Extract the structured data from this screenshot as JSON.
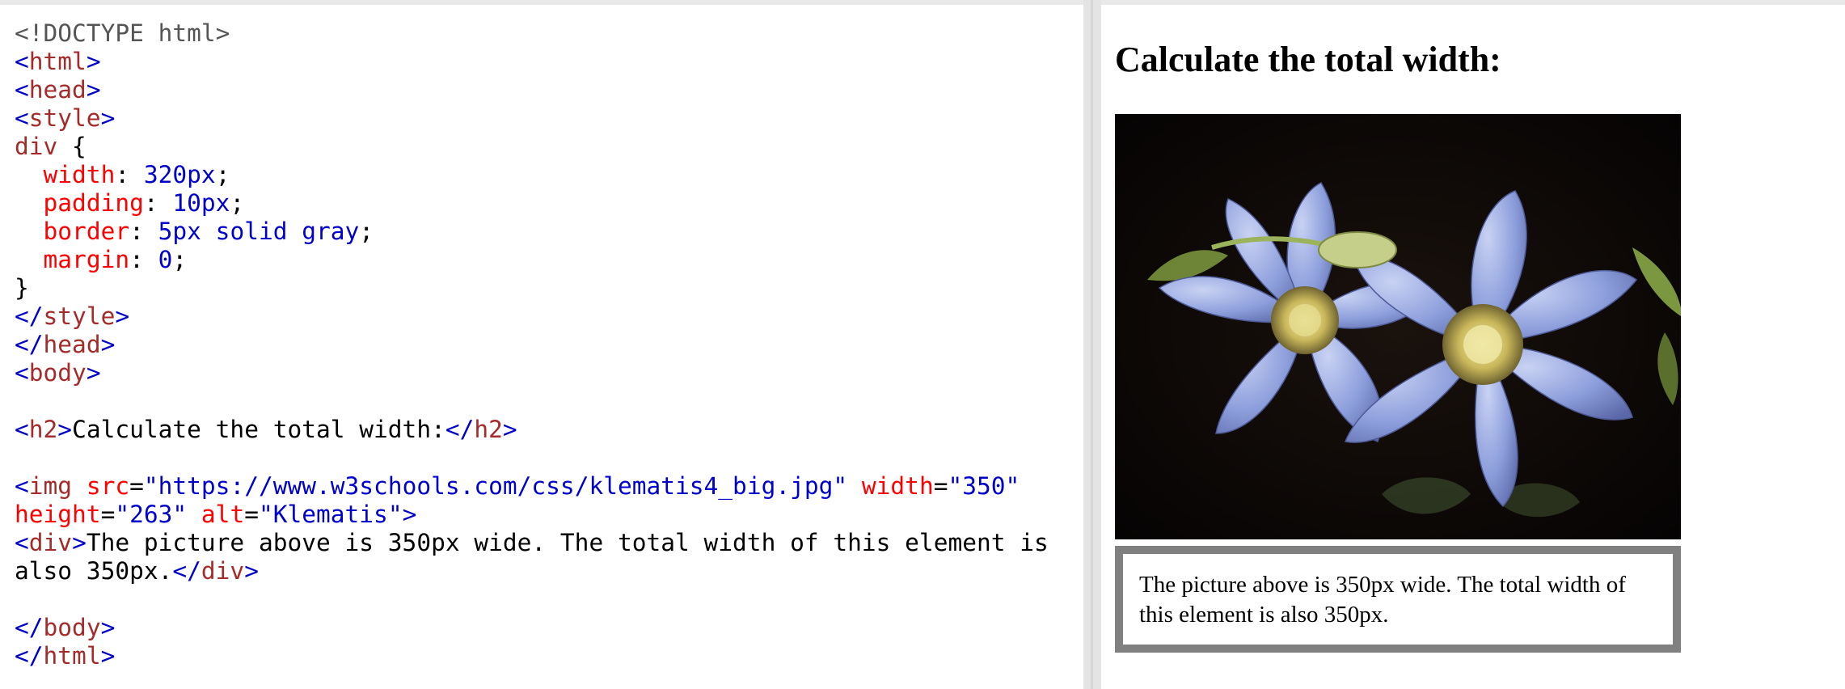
{
  "editor": {
    "lines": [
      [
        {
          "t": "<!DOCTYPE html>",
          "c": "t-doctype"
        }
      ],
      [
        {
          "t": "<",
          "c": "t-bracket"
        },
        {
          "t": "html",
          "c": "t-tag"
        },
        {
          "t": ">",
          "c": "t-bracket"
        }
      ],
      [
        {
          "t": "<",
          "c": "t-bracket"
        },
        {
          "t": "head",
          "c": "t-tag"
        },
        {
          "t": ">",
          "c": "t-bracket"
        }
      ],
      [
        {
          "t": "<",
          "c": "t-bracket"
        },
        {
          "t": "style",
          "c": "t-tag"
        },
        {
          "t": ">",
          "c": "t-bracket"
        }
      ],
      [
        {
          "t": "div",
          "c": "t-sel"
        },
        {
          "t": " {",
          "c": "t-punc"
        }
      ],
      [
        {
          "t": "  ",
          "c": "t-punc"
        },
        {
          "t": "width",
          "c": "t-prop"
        },
        {
          "t": ": ",
          "c": "t-punc"
        },
        {
          "t": "320px",
          "c": "t-pval"
        },
        {
          "t": ";",
          "c": "t-punc"
        }
      ],
      [
        {
          "t": "  ",
          "c": "t-punc"
        },
        {
          "t": "padding",
          "c": "t-prop"
        },
        {
          "t": ": ",
          "c": "t-punc"
        },
        {
          "t": "10px",
          "c": "t-pval"
        },
        {
          "t": ";",
          "c": "t-punc"
        }
      ],
      [
        {
          "t": "  ",
          "c": "t-punc"
        },
        {
          "t": "border",
          "c": "t-prop"
        },
        {
          "t": ": ",
          "c": "t-punc"
        },
        {
          "t": "5px solid gray",
          "c": "t-pval"
        },
        {
          "t": ";",
          "c": "t-punc"
        }
      ],
      [
        {
          "t": "  ",
          "c": "t-punc"
        },
        {
          "t": "margin",
          "c": "t-prop"
        },
        {
          "t": ": ",
          "c": "t-punc"
        },
        {
          "t": "0",
          "c": "t-pval"
        },
        {
          "t": ";",
          "c": "t-punc"
        }
      ],
      [
        {
          "t": "}",
          "c": "t-punc"
        }
      ],
      [
        {
          "t": "</",
          "c": "t-bracket"
        },
        {
          "t": "style",
          "c": "t-tag"
        },
        {
          "t": ">",
          "c": "t-bracket"
        }
      ],
      [
        {
          "t": "</",
          "c": "t-bracket"
        },
        {
          "t": "head",
          "c": "t-tag"
        },
        {
          "t": ">",
          "c": "t-bracket"
        }
      ],
      [
        {
          "t": "<",
          "c": "t-bracket"
        },
        {
          "t": "body",
          "c": "t-tag"
        },
        {
          "t": ">",
          "c": "t-bracket"
        }
      ],
      [],
      [
        {
          "t": "<",
          "c": "t-bracket"
        },
        {
          "t": "h2",
          "c": "t-tag"
        },
        {
          "t": ">",
          "c": "t-bracket"
        },
        {
          "t": "Calculate the total width:",
          "c": "t-text"
        },
        {
          "t": "</",
          "c": "t-bracket"
        },
        {
          "t": "h2",
          "c": "t-tag"
        },
        {
          "t": ">",
          "c": "t-bracket"
        }
      ],
      [],
      [
        {
          "t": "<",
          "c": "t-bracket"
        },
        {
          "t": "img",
          "c": "t-tag"
        },
        {
          "t": " src",
          "c": "t-attr"
        },
        {
          "t": "=",
          "c": "t-punc"
        },
        {
          "t": "\"https://www.w3schools.com/css/klematis4_big.jpg\"",
          "c": "t-val"
        },
        {
          "t": " width",
          "c": "t-attr"
        },
        {
          "t": "=",
          "c": "t-punc"
        },
        {
          "t": "\"350\"",
          "c": "t-val"
        }
      ],
      [
        {
          "t": "height",
          "c": "t-attr"
        },
        {
          "t": "=",
          "c": "t-punc"
        },
        {
          "t": "\"263\"",
          "c": "t-val"
        },
        {
          "t": " alt",
          "c": "t-attr"
        },
        {
          "t": "=",
          "c": "t-punc"
        },
        {
          "t": "\"Klematis\"",
          "c": "t-val"
        },
        {
          "t": ">",
          "c": "t-bracket"
        }
      ],
      [
        {
          "t": "<",
          "c": "t-bracket"
        },
        {
          "t": "div",
          "c": "t-tag"
        },
        {
          "t": ">",
          "c": "t-bracket"
        },
        {
          "t": "The picture above is 350px wide. The total width of this element is",
          "c": "t-text"
        }
      ],
      [
        {
          "t": "also 350px.",
          "c": "t-text"
        },
        {
          "t": "</",
          "c": "t-bracket"
        },
        {
          "t": "div",
          "c": "t-tag"
        },
        {
          "t": ">",
          "c": "t-bracket"
        }
      ],
      [],
      [
        {
          "t": "</",
          "c": "t-bracket"
        },
        {
          "t": "body",
          "c": "t-tag"
        },
        {
          "t": ">",
          "c": "t-bracket"
        }
      ],
      [
        {
          "t": "</",
          "c": "t-bracket"
        },
        {
          "t": "html",
          "c": "t-tag"
        },
        {
          "t": ">",
          "c": "t-bracket"
        }
      ]
    ]
  },
  "result": {
    "heading": "Calculate the total width:",
    "image_alt": "Klematis",
    "box_text": "The picture above is 350px wide. The total width of this element is also 350px."
  },
  "colors": {
    "tag": "#a52a2a",
    "bracket": "#0000cd",
    "attribute": "#ff0000",
    "value": "#0000cd",
    "border_gray": "#808080",
    "photo_background": "#0b0706",
    "petal": "#8d9fdc"
  }
}
